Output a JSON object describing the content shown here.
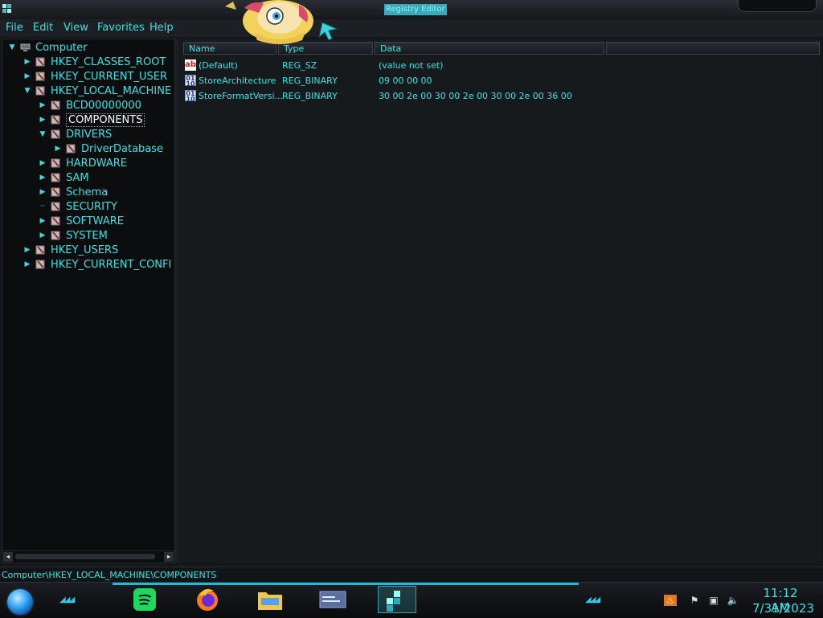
{
  "window": {
    "title": "Registry Editor"
  },
  "menu": [
    "File",
    "Edit",
    "View",
    "Favorites",
    "Help"
  ],
  "tree": [
    {
      "label": "Computer",
      "level": 0,
      "expander": "open",
      "icon": "computer-icon"
    },
    {
      "label": "HKEY_CLASSES_ROOT",
      "level": 1,
      "expander": "closed",
      "icon": "folder-icon"
    },
    {
      "label": "HKEY_CURRENT_USER",
      "level": 1,
      "expander": "closed",
      "icon": "folder-icon"
    },
    {
      "label": "HKEY_LOCAL_MACHINE",
      "level": 1,
      "expander": "open",
      "icon": "folder-icon"
    },
    {
      "label": "BCD00000000",
      "level": 2,
      "expander": "closed",
      "icon": "folder-icon"
    },
    {
      "label": "COMPONENTS",
      "level": 2,
      "expander": "closed",
      "icon": "folder-icon",
      "selected": true
    },
    {
      "label": "DRIVERS",
      "level": 2,
      "expander": "open",
      "icon": "folder-icon"
    },
    {
      "label": "DriverDatabase",
      "level": 3,
      "expander": "closed",
      "icon": "folder-icon"
    },
    {
      "label": "HARDWARE",
      "level": 2,
      "expander": "closed",
      "icon": "folder-icon"
    },
    {
      "label": "SAM",
      "level": 2,
      "expander": "closed",
      "icon": "folder-icon"
    },
    {
      "label": "Schema",
      "level": 2,
      "expander": "closed",
      "icon": "folder-icon"
    },
    {
      "label": "SECURITY",
      "level": 2,
      "expander": "none",
      "icon": "folder-icon"
    },
    {
      "label": "SOFTWARE",
      "level": 2,
      "expander": "closed",
      "icon": "folder-icon"
    },
    {
      "label": "SYSTEM",
      "level": 2,
      "expander": "closed",
      "icon": "folder-icon"
    },
    {
      "label": "HKEY_USERS",
      "level": 1,
      "expander": "closed",
      "icon": "folder-icon"
    },
    {
      "label": "HKEY_CURRENT_CONFI",
      "level": 1,
      "expander": "closed",
      "icon": "folder-icon"
    }
  ],
  "list": {
    "columns": [
      "Name",
      "Type",
      "Data",
      ""
    ],
    "rows": [
      {
        "icon": "string-value-icon",
        "name": "(Default)",
        "type": "REG_SZ",
        "data": "(value not set)"
      },
      {
        "icon": "binary-value-icon",
        "name": "StoreArchitecture",
        "type": "REG_BINARY",
        "data": "09 00 00 00"
      },
      {
        "icon": "binary-value-icon",
        "name": "StoreFormatVersi...",
        "type": "REG_BINARY",
        "data": "30 00 2e 00 30 00 2e 00 30 00 2e 00 36 00"
      }
    ]
  },
  "status": {
    "path": "Computer\\HKEY_LOCAL_MACHINE\\COMPONENTS"
  },
  "taskbar": {
    "apps": [
      {
        "name": "spotify-icon"
      },
      {
        "name": "firefox-icon"
      },
      {
        "name": "file-explorer-icon"
      },
      {
        "name": "app-window-icon"
      },
      {
        "name": "registry-editor-icon",
        "active": true
      }
    ],
    "tray": [
      "java-icon",
      "flag-icon",
      "network-icon",
      "volume-icon"
    ],
    "time": "11:12 AM",
    "date": "7/31/2023"
  },
  "colors": {
    "accent": "#3fe0e0",
    "background": "#161a1c",
    "tree_background": "#0b0d0f"
  }
}
